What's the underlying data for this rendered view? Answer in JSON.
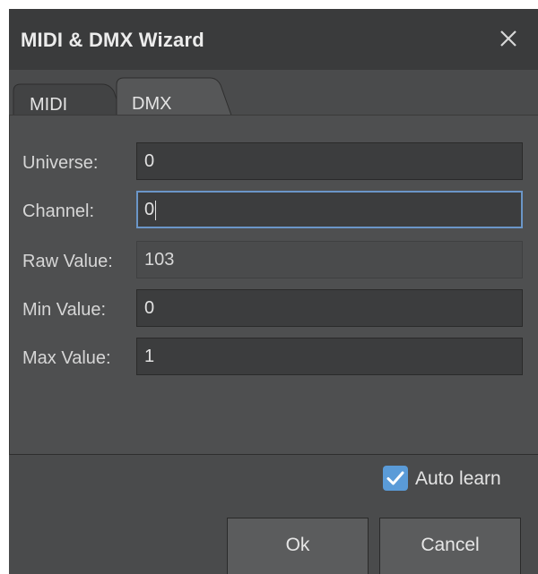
{
  "window": {
    "title": "MIDI & DMX Wizard",
    "close_icon": "close-icon"
  },
  "tabs": [
    {
      "label": "MIDI",
      "active": false
    },
    {
      "label": "DMX",
      "active": true
    }
  ],
  "fields": {
    "universe": {
      "label": "Universe:",
      "value": "0"
    },
    "channel": {
      "label": "Channel:",
      "value": "0",
      "focused": true
    },
    "raw_value": {
      "label": "Raw Value:",
      "value": "103",
      "readonly": true
    },
    "min_value": {
      "label": "Min Value:",
      "value": "0"
    },
    "max_value": {
      "label": "Max Value:",
      "value": "1"
    }
  },
  "auto_learn": {
    "label": "Auto learn",
    "checked": true
  },
  "buttons": {
    "ok": "Ok",
    "cancel": "Cancel"
  },
  "colors": {
    "accent": "#5a9bd8",
    "focus_border": "#6b96c8",
    "window_bg": "#4a4b4c",
    "titlebar_bg": "#3a3b3c"
  }
}
